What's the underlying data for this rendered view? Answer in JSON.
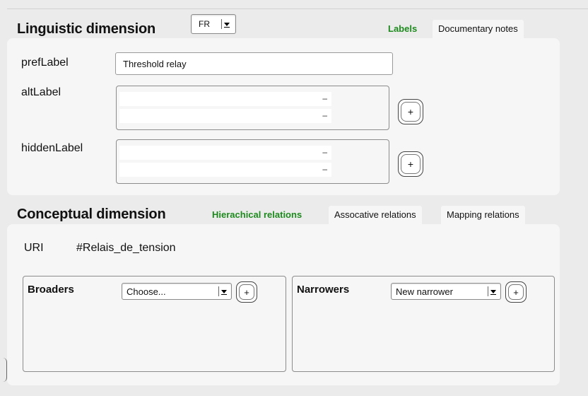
{
  "linguistic": {
    "title": "Linguistic dimension",
    "language": "FR",
    "tabs": [
      "Labels",
      "Documentary notes"
    ],
    "pref_label_caption": "prefLabel",
    "pref_label_value": "Threshold relay",
    "alt_label_caption": "altLabel",
    "hidden_label_caption": "hiddenLabel",
    "row_remove_symbol": "–",
    "add_symbol": "+"
  },
  "conceptual": {
    "title": "Conceptual dimension",
    "tabs": [
      "Hierachical relations",
      "Assocative relations",
      "Mapping relations"
    ],
    "uri_caption": "URI",
    "uri_value": "#Relais_de_tension",
    "broaders": {
      "label": "Broaders",
      "selected": "Choose..."
    },
    "narrowers": {
      "label": "Narrowers",
      "selected": "New narrower"
    }
  },
  "colors": {
    "active_tab": "#1d8a1d",
    "panel": "#f6f6f6",
    "background": "#ebebeb"
  }
}
